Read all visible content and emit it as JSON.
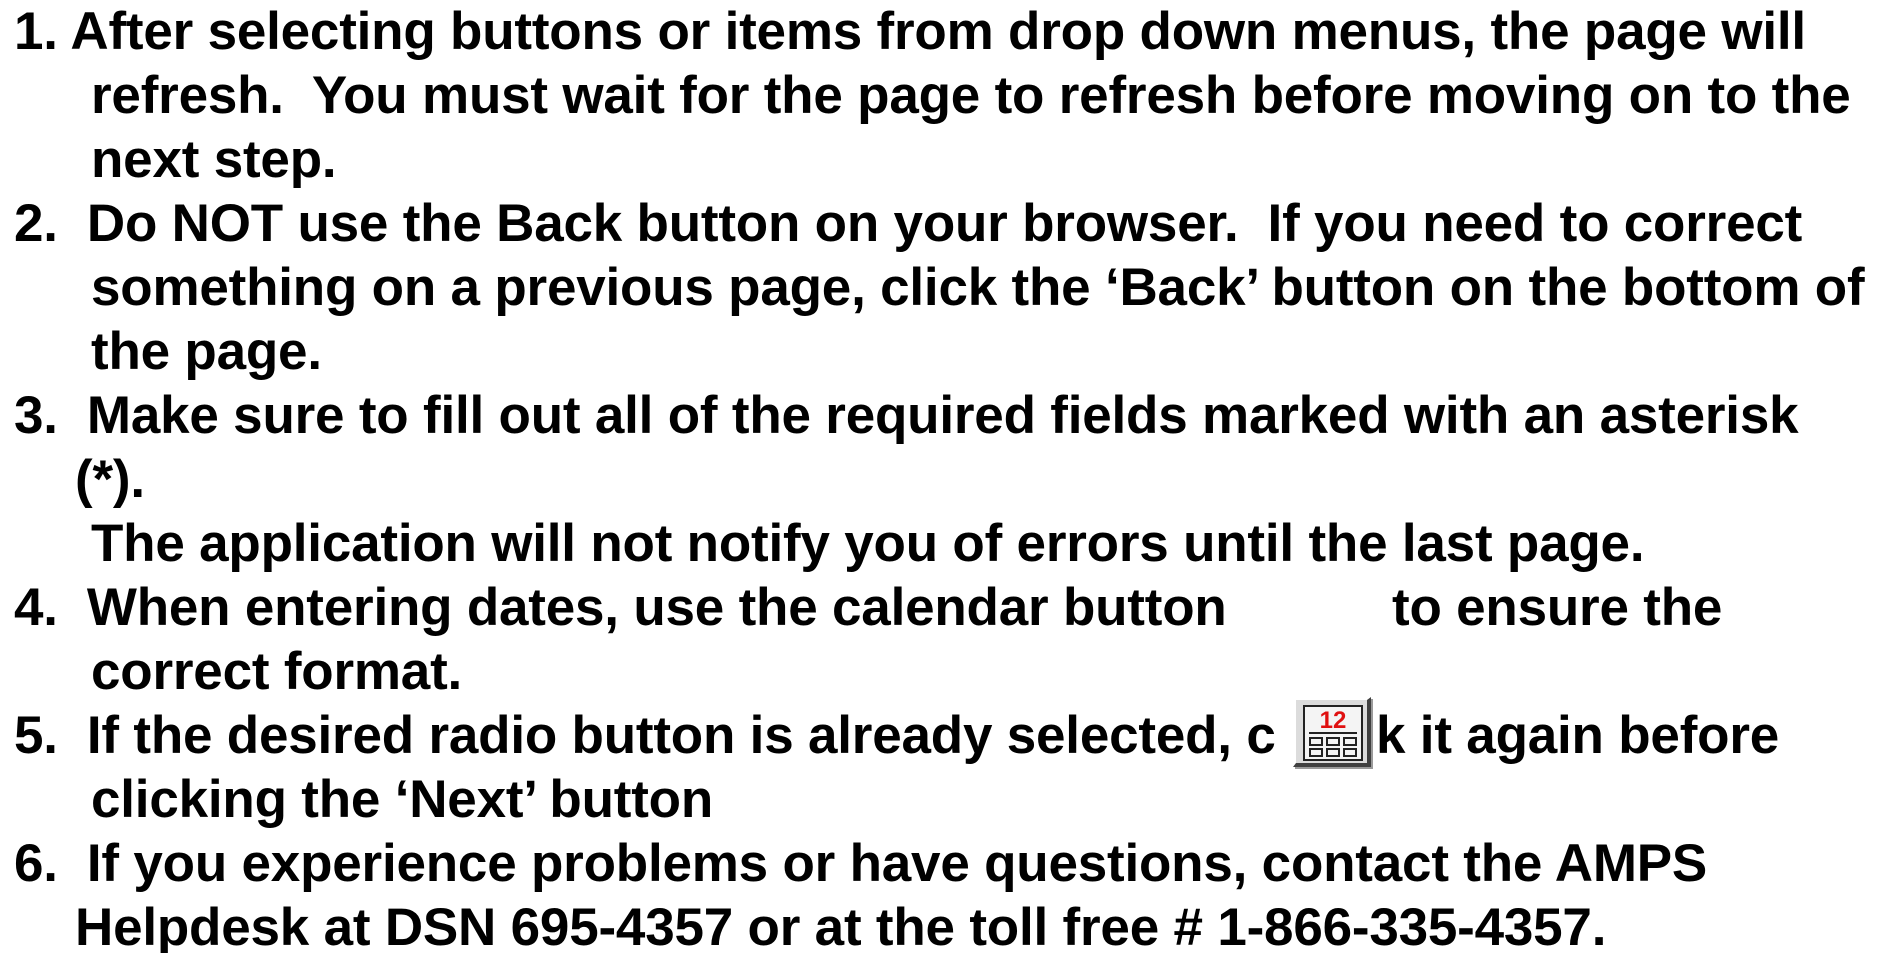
{
  "instructions": [
    {
      "number": "1.",
      "lines": [
        "After selecting buttons or items from drop down menus, the page will",
        "refresh.  You must wait for the page to refresh before moving on to the",
        "next step."
      ]
    },
    {
      "number": "2.",
      "lines": [
        "Do NOT use the Back button on your browser.  If you need to correct",
        "something on a previous page, click the ‘Back’ button on the bottom of",
        "the page."
      ]
    },
    {
      "number": "3.",
      "lines": [
        "Make sure to fill out all of the required fields marked with an asterisk",
        "(*).",
        "The application will not notify you of errors until the last page."
      ]
    },
    {
      "number": "4.",
      "lines": [
        "When entering dates, use the calendar button",
        "to ensure the",
        "correct format."
      ]
    },
    {
      "number": "5.",
      "lines": [
        "If the desired radio button is already selected, c",
        "k it again before",
        "clicking the ‘Next’ button"
      ]
    },
    {
      "number": "6.",
      "lines": [
        "If you experience problems or have questions, contact the AMPS",
        "Helpdesk at DSN 695-4357 or at the toll free # 1-866-335-4357."
      ]
    }
  ],
  "calendar_icon": {
    "icon": "calendar-icon",
    "glyph_top": "12",
    "accent_color": "#e01010"
  }
}
